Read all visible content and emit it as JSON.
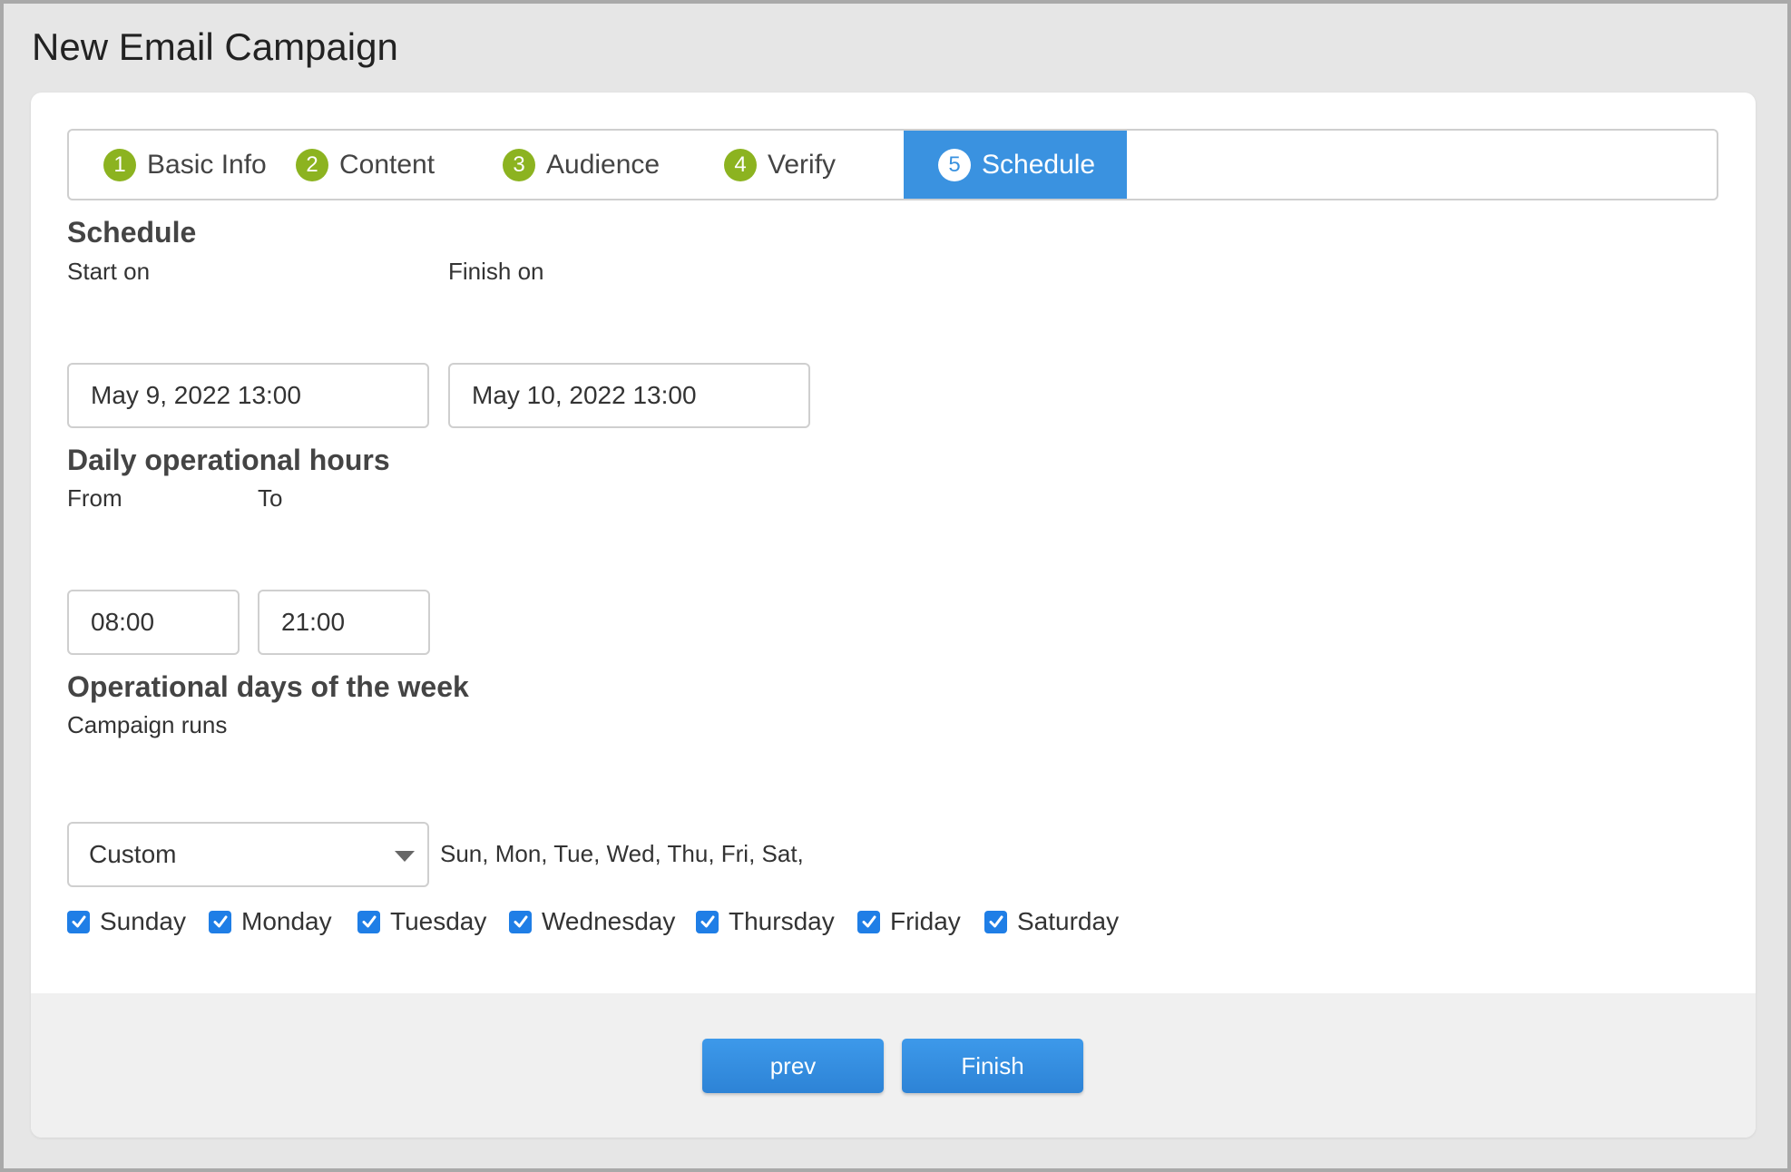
{
  "page": {
    "title": "New Email Campaign"
  },
  "steps": [
    {
      "number": "1",
      "label": "Basic Info",
      "state": "completed"
    },
    {
      "number": "2",
      "label": "Content",
      "state": "completed"
    },
    {
      "number": "3",
      "label": "Audience",
      "state": "completed"
    },
    {
      "number": "4",
      "label": "Verify",
      "state": "completed"
    },
    {
      "number": "5",
      "label": "Schedule",
      "state": "active"
    }
  ],
  "schedule": {
    "title": "Schedule",
    "start_label": "Start on",
    "start_value": "May 9, 2022 13:00",
    "finish_label": "Finish on",
    "finish_value": "May 10, 2022 13:00"
  },
  "hours": {
    "title": "Daily operational hours",
    "from_label": "From",
    "from_value": "08:00",
    "to_label": "To",
    "to_value": "21:00"
  },
  "days": {
    "title": "Operational days of the week",
    "runs_label": "Campaign runs",
    "runs_value": "Custom",
    "summary": "Sun, Mon, Tue, Wed, Thu, Fri, Sat,",
    "options": [
      {
        "label": "Sunday",
        "checked": true
      },
      {
        "label": "Monday",
        "checked": true
      },
      {
        "label": "Tuesday",
        "checked": true
      },
      {
        "label": "Wednesday",
        "checked": true
      },
      {
        "label": "Thursday",
        "checked": true
      },
      {
        "label": "Friday",
        "checked": true
      },
      {
        "label": "Saturday",
        "checked": true
      }
    ]
  },
  "buttons": {
    "prev": "prev",
    "finish": "Finish"
  },
  "colors": {
    "accent": "#3a92e0",
    "step_done": "#8cb320",
    "checkbox": "#1f7ee6"
  }
}
